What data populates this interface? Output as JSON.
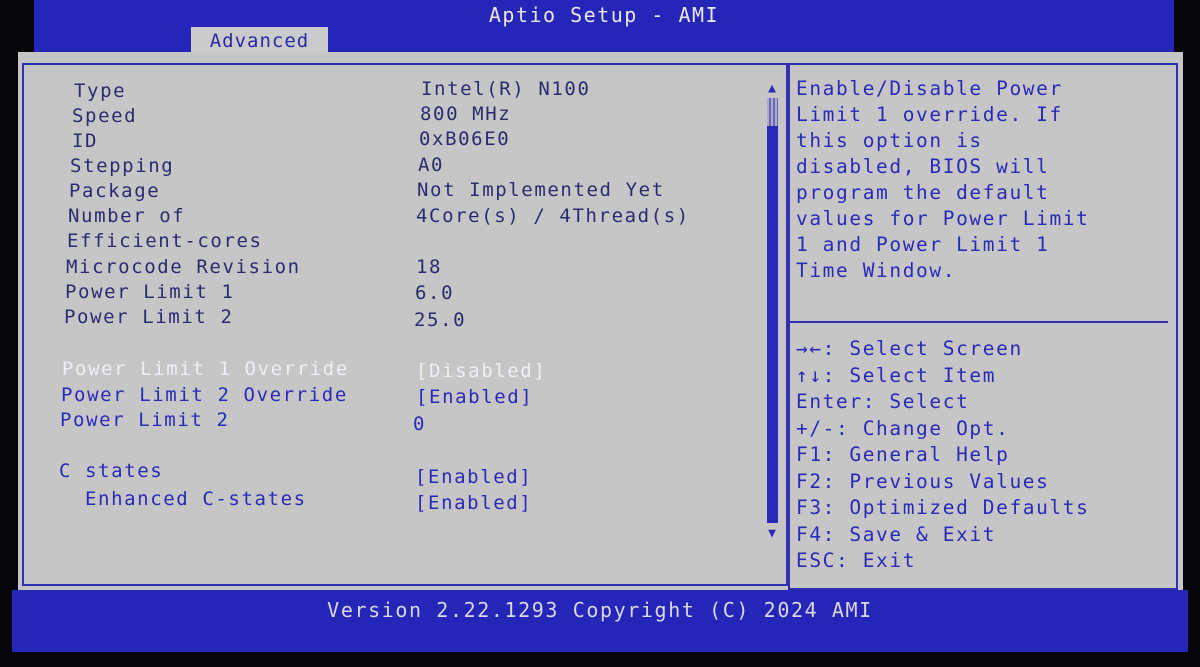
{
  "header": {
    "title": "Aptio Setup - AMI",
    "tab": "Advanced"
  },
  "info_rows": [
    {
      "label": "Type",
      "value": "Intel(R) N100"
    },
    {
      "label": "Speed",
      "value": "800 MHz"
    },
    {
      "label": "ID",
      "value": "0xB06E0"
    },
    {
      "label": "Stepping",
      "value": "A0"
    },
    {
      "label": "Package",
      "value": "Not Implemented Yet"
    },
    {
      "label": "Number of",
      "value": "4Core(s) / 4Thread(s)"
    },
    {
      "label": "Efficient-cores",
      "value": ""
    },
    {
      "label": "Microcode Revision",
      "value": "18"
    },
    {
      "label": "Power Limit 1",
      "value": "6.0"
    },
    {
      "label": "Power Limit 2",
      "value": "25.0"
    }
  ],
  "options": [
    {
      "label": "Power Limit 1 Override",
      "value": "[Disabled]",
      "selected": true
    },
    {
      "label": "Power Limit 2 Override",
      "value": "[Enabled]",
      "selected": false
    },
    {
      "label": "Power Limit 2",
      "value": "0",
      "selected": false
    }
  ],
  "cstates": [
    {
      "label": "C states",
      "value": "[Enabled]"
    },
    {
      "label": "Enhanced C-states",
      "value": "[Enabled]"
    }
  ],
  "help": {
    "lines": [
      "Enable/Disable Power",
      "Limit 1 override. If",
      "this option is",
      "disabled, BIOS will",
      "program the default",
      "values for Power Limit",
      "1 and Power Limit 1",
      "Time Window."
    ]
  },
  "keys": [
    "→←: Select Screen",
    "↑↓: Select Item",
    "Enter: Select",
    "+/-: Change Opt.",
    "F1: General Help",
    "F2: Previous Values",
    "F3: Optimized Defaults",
    "F4: Save & Exit",
    "ESC: Exit"
  ],
  "footer": {
    "version": "Version 2.22.1293 Copyright (C) 2024 AMI"
  },
  "colors": {
    "bar_blue": "#2525b8",
    "panel_gray": "#c6c6c6",
    "option_blue": "#2a2ab8",
    "info_text": "#2b2b70",
    "selected_text": "#eeeef6"
  }
}
